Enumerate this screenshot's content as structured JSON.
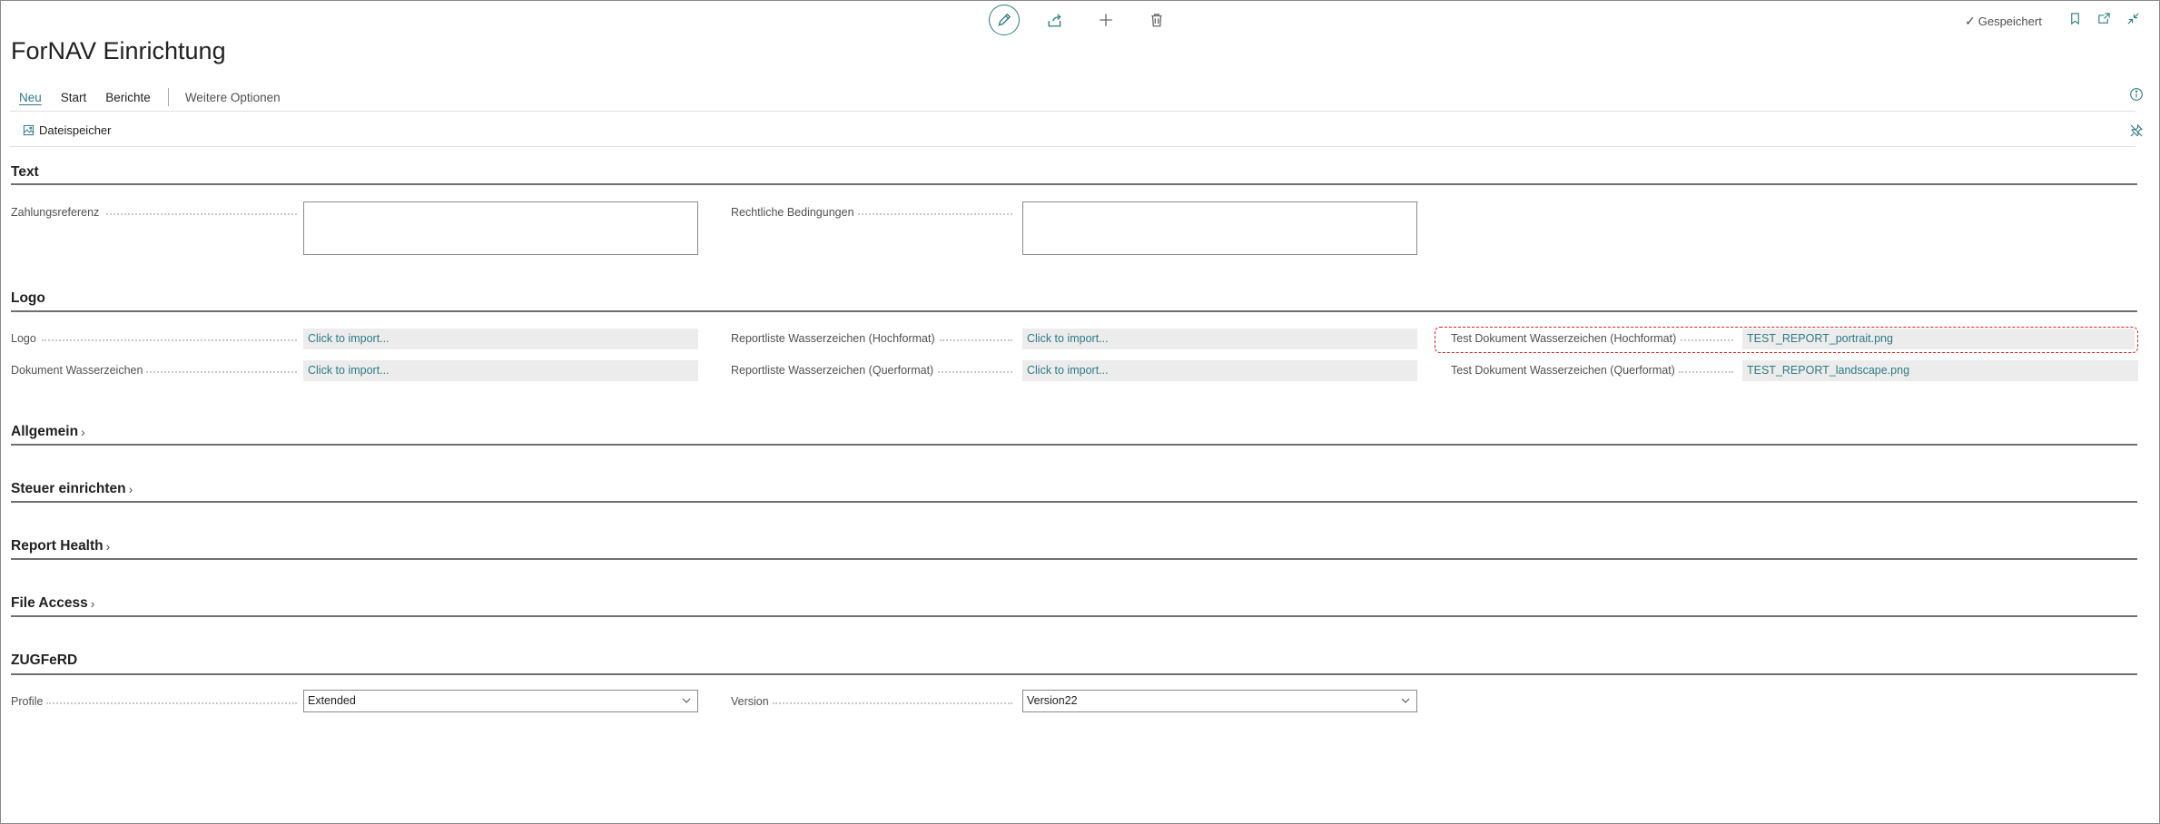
{
  "page": {
    "title": "ForNAV Einrichtung",
    "saved_label": "Gespeichert"
  },
  "toolbar_icons": [
    "edit-icon",
    "share-icon",
    "add-icon",
    "delete-icon"
  ],
  "header_right_icons": [
    "bookmark-icon",
    "open-new-window-icon",
    "collapse-icon"
  ],
  "actionbar": {
    "tabs": [
      "Neu",
      "Start",
      "Berichte"
    ],
    "more": "Weitere Optionen",
    "sub_action": "Dateispeicher"
  },
  "sections": {
    "text": {
      "title": "Text",
      "zahlungsreferenz_label": "Zahlungsreferenz",
      "zahlungsreferenz_value": "",
      "rechtliche_label": "Rechtliche Bedingungen",
      "rechtliche_value": ""
    },
    "logo": {
      "title": "Logo",
      "logo_label": "Logo",
      "logo_value": "Click to import...",
      "dok_wasserzeichen_label": "Dokument Wasserzeichen",
      "dok_wasserzeichen_value": "Click to import...",
      "rl_hoch_label": "Reportliste Wasserzeichen (Hochformat)",
      "rl_hoch_value": "Click to import...",
      "rl_quer_label": "Reportliste Wasserzeichen (Querformat)",
      "rl_quer_value": "Click to import...",
      "td_hoch_label": "Test Dokument Wasserzeichen (Hochformat)",
      "td_hoch_value": "TEST_REPORT_portrait.png",
      "td_quer_label": "Test Dokument Wasserzeichen (Querformat)",
      "td_quer_value": "TEST_REPORT_landscape.png"
    },
    "allgemein": {
      "title": "Allgemein"
    },
    "steuer": {
      "title": "Steuer einrichten"
    },
    "health": {
      "title": "Report Health"
    },
    "fileaccess": {
      "title": "File Access"
    },
    "zugferd": {
      "title": "ZUGFeRD",
      "profile_label": "Profile",
      "profile_value": "Extended",
      "version_label": "Version",
      "version_value": "Version22"
    }
  },
  "colors": {
    "accent": "#2c7b84",
    "highlight": "#e02020"
  }
}
